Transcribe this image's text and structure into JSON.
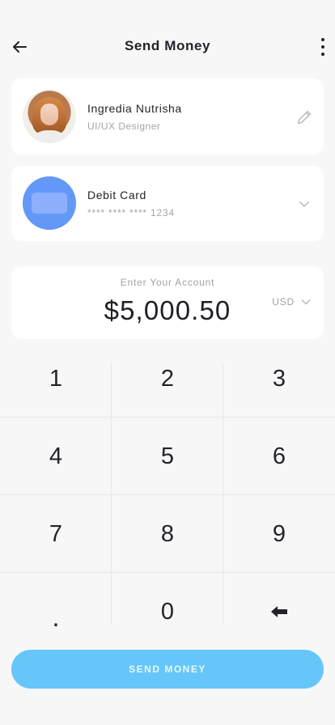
{
  "header": {
    "title": "Send Money",
    "back_icon": "arrow-left-icon",
    "more_icon": "more-vertical-icon"
  },
  "recipient": {
    "name": "Ingredia Nutrisha",
    "role": "UI/UX Designer",
    "edit_icon": "pencil-icon"
  },
  "payment_method": {
    "title": "Debit Card",
    "masked_number": "**** **** **** 1234",
    "icon": "card-icon",
    "dropdown_icon": "chevron-down-icon"
  },
  "amount": {
    "label": "Enter Your Account",
    "value": "$5,000.50",
    "currency": "USD",
    "currency_icon": "chevron-down-icon"
  },
  "keypad": {
    "keys": [
      "1",
      "2",
      "3",
      "4",
      "5",
      "6",
      "7",
      "8",
      "9",
      ".",
      "0",
      "backspace"
    ]
  },
  "send_button": {
    "label": "SEND MONEY"
  },
  "colors": {
    "background": "#f7f7f8",
    "card": "#ffffff",
    "accent": "#66c6f9",
    "card_icon": "#6398f8"
  }
}
